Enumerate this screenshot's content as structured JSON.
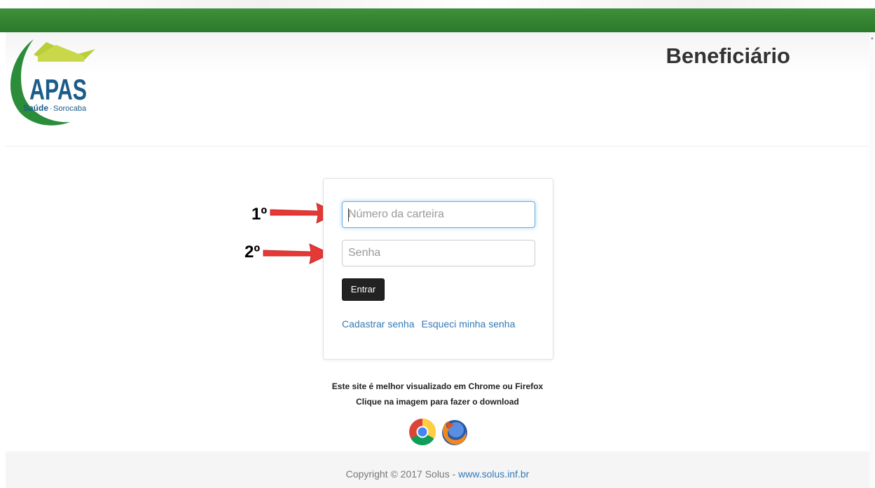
{
  "header": {
    "title": "Beneficiário",
    "logo": {
      "text": "APAS",
      "subtitle_1": "Saúde",
      "subtitle_2": "Sorocaba"
    }
  },
  "login": {
    "card_placeholder": "Número da carteira",
    "password_placeholder": "Senha",
    "submit_label": "Entrar",
    "register_link": "Cadastrar senha",
    "forgot_link": "Esqueci minha senha"
  },
  "annotations": {
    "step1": "1º",
    "step2": "2º"
  },
  "notice": {
    "line1": "Este site é melhor visualizado em Chrome ou Firefox",
    "line2": "Clique na imagem para fazer o download",
    "browsers": [
      "chrome-icon",
      "firefox-icon"
    ]
  },
  "footer": {
    "copyright_text": "Copyright © 2017 Solus - ",
    "copyright_link": "www.solus.inf.br"
  },
  "colors": {
    "brand_green": "#2b7a2a",
    "logo_blue": "#1a5c8a",
    "link_blue": "#337ab7",
    "arrow_red": "#e53935"
  }
}
